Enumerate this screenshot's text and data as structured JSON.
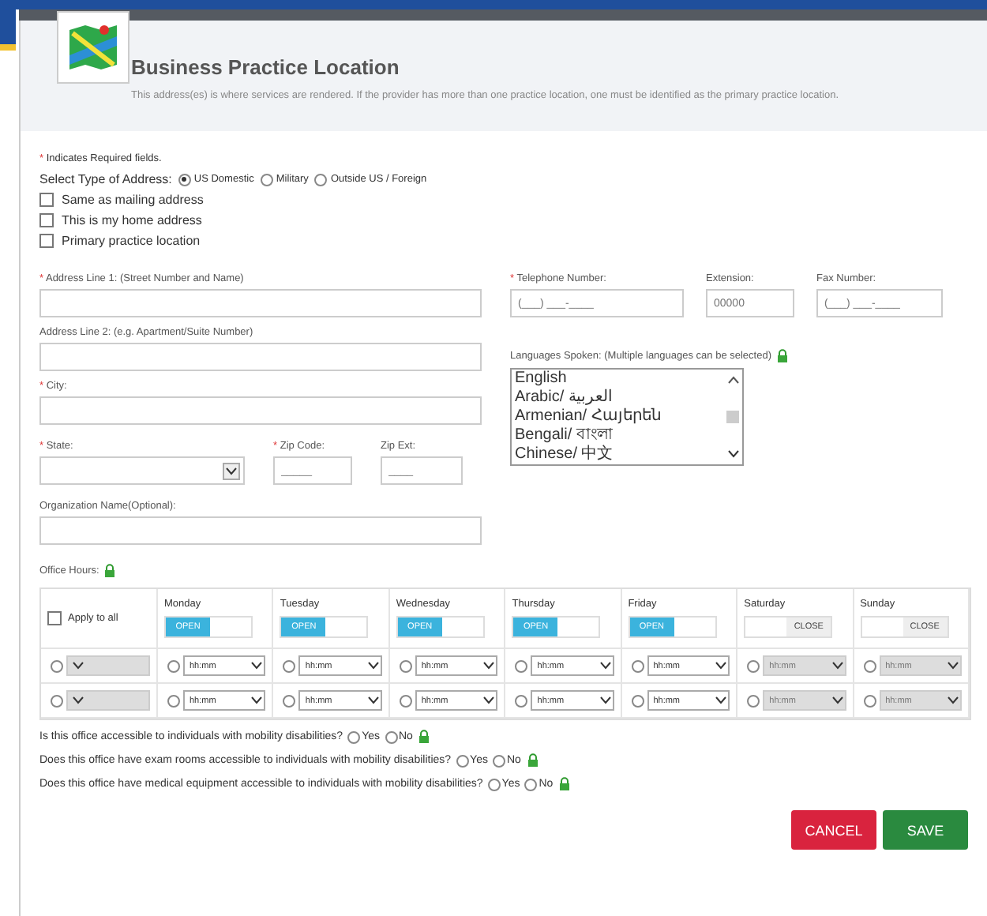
{
  "header": {
    "title": "Business Practice Location",
    "description": "This address(es) is where services are rendered. If the provider has more than one practice location, one must be identified as the primary practice location."
  },
  "required_note": {
    "marker": "*",
    "text": "Indicates Required fields."
  },
  "address_type": {
    "label": "Select Type of Address:",
    "options": [
      {
        "label": "US Domestic",
        "selected": true
      },
      {
        "label": "Military",
        "selected": false
      },
      {
        "label": "Outside US / Foreign",
        "selected": false
      }
    ]
  },
  "checkboxes": [
    {
      "label": "Same as mailing address",
      "checked": false
    },
    {
      "label": "This is my home address",
      "checked": false
    },
    {
      "label": "Primary practice location",
      "checked": false
    }
  ],
  "address_line_1": {
    "marker": "*",
    "label": "Address Line 1: (Street Number and Name)"
  },
  "address_line_2": {
    "label": "Address Line 2: (e.g. Apartment/Suite Number)"
  },
  "city": {
    "marker": "*",
    "label": "City:"
  },
  "state": {
    "marker": "*",
    "label": "State:"
  },
  "zip_code": {
    "marker": "*",
    "label": "Zip Code:",
    "placeholder": "_____"
  },
  "zip_ext": {
    "label": "Zip Ext:",
    "placeholder": "____"
  },
  "organization_name": {
    "label": "Organization Name(Optional):"
  },
  "telephone": {
    "marker": "*",
    "label": "Telephone Number:",
    "placeholder": "(___) ___-____"
  },
  "extension": {
    "label": "Extension:",
    "placeholder": "00000"
  },
  "fax": {
    "label": "Fax Number:",
    "placeholder": "(___) ___-____"
  },
  "languages": {
    "label": "Languages Spoken: (Multiple languages can be selected)",
    "items": [
      "English",
      "Arabic/ العربية",
      "Armenian/ Հայերեն",
      "Bengali/ বাংলা",
      "Chinese/ 中文"
    ]
  },
  "office_hours": {
    "label": "Office Hours:",
    "apply_to_all": {
      "label": "Apply to all",
      "checked": false
    },
    "all_slots": [
      {
        "selected": false
      },
      {
        "selected": false
      }
    ],
    "days": [
      {
        "name": "Monday",
        "open": true,
        "toggle": "OPEN",
        "slots": [
          {
            "time": "hh:mm",
            "selected": false
          },
          {
            "time": "hh:mm",
            "selected": false
          }
        ]
      },
      {
        "name": "Tuesday",
        "open": true,
        "toggle": "OPEN",
        "slots": [
          {
            "time": "hh:mm",
            "selected": false
          },
          {
            "time": "hh:mm",
            "selected": false
          }
        ]
      },
      {
        "name": "Wednesday",
        "open": true,
        "toggle": "OPEN",
        "slots": [
          {
            "time": "hh:mm",
            "selected": false
          },
          {
            "time": "hh:mm",
            "selected": false
          }
        ]
      },
      {
        "name": "Thursday",
        "open": true,
        "toggle": "OPEN",
        "slots": [
          {
            "time": "hh:mm",
            "selected": false
          },
          {
            "time": "hh:mm",
            "selected": false
          }
        ]
      },
      {
        "name": "Friday",
        "open": true,
        "toggle": "OPEN",
        "slots": [
          {
            "time": "hh:mm",
            "selected": false
          },
          {
            "time": "hh:mm",
            "selected": false
          }
        ]
      },
      {
        "name": "Saturday",
        "open": false,
        "toggle": "CLOSE",
        "slots": [
          {
            "time": "hh:mm",
            "selected": false
          },
          {
            "time": "hh:mm",
            "selected": false
          }
        ]
      },
      {
        "name": "Sunday",
        "open": false,
        "toggle": "CLOSE",
        "slots": [
          {
            "time": "hh:mm",
            "selected": false
          },
          {
            "time": "hh:mm",
            "selected": false
          }
        ]
      }
    ]
  },
  "questions": [
    {
      "text": "Is this office accessible to individuals with mobility disabilities?",
      "options": [
        {
          "label": "Yes",
          "selected": false
        },
        {
          "label": "No",
          "selected": false
        }
      ]
    },
    {
      "text": "Does this office have exam rooms accessible to individuals with mobility disabilities?",
      "options": [
        {
          "label": "Yes",
          "selected": false
        },
        {
          "label": "No",
          "selected": false
        }
      ]
    },
    {
      "text": "Does this office have medical equipment accessible to individuals with mobility disabilities?",
      "options": [
        {
          "label": "Yes",
          "selected": false
        },
        {
          "label": "No",
          "selected": false
        }
      ]
    }
  ],
  "buttons": [
    {
      "label": "CANCEL",
      "kind": "cancel"
    },
    {
      "label": "SAVE",
      "kind": "save"
    }
  ]
}
